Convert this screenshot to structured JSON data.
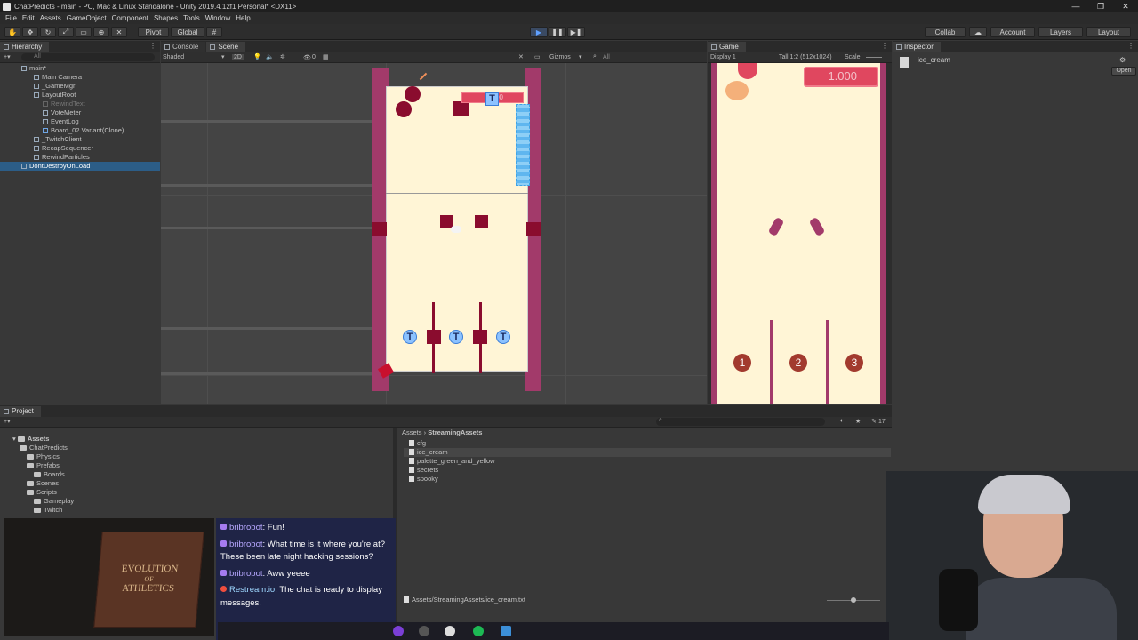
{
  "window": {
    "title": "ChatPredicts - main - PC, Mac & Linux Standalone - Unity 2019.4.12f1 Personal* <DX11>",
    "minimize": "—",
    "maximize": "❐",
    "close": "✕"
  },
  "menu": [
    "File",
    "Edit",
    "Assets",
    "GameObject",
    "Component",
    "Shapes",
    "Tools",
    "Window",
    "Help"
  ],
  "toolbar": {
    "pivot": "Pivot",
    "global": "Global",
    "collab": "Collab",
    "account": "Account",
    "layers": "Layers",
    "layout": "Layout"
  },
  "hierarchy": {
    "tab": "Hierarchy",
    "search_placeholder": "All",
    "items": [
      {
        "label": "main*"
      },
      {
        "label": "Main Camera"
      },
      {
        "label": "_GameMgr"
      },
      {
        "label": "LayoutRoot"
      },
      {
        "label": "RewindText"
      },
      {
        "label": "VoteMeter"
      },
      {
        "label": "EventLog"
      },
      {
        "label": "Board_02 Variant(Clone)"
      },
      {
        "label": "_TwitchClient"
      },
      {
        "label": "RecapSequencer"
      },
      {
        "label": "RewindParticles"
      },
      {
        "label": "DontDestroyOnLoad"
      }
    ]
  },
  "scene": {
    "tabs": [
      "Console",
      "Scene"
    ],
    "shading": "Shaded",
    "mode_2d": "2D",
    "layer_count": "0",
    "gizmos": "Gizmos",
    "search_placeholder": "All",
    "label_text": "1000",
    "t_icon": "T"
  },
  "game": {
    "tab": "Game",
    "display": "Display 1",
    "aspect": "Tall 1:2 (512x1024)",
    "scale_label": "Scale",
    "score": "1.000",
    "peg_labels": [
      "1",
      "2",
      "3"
    ]
  },
  "inspector": {
    "tab": "Inspector",
    "asset_name": "ice_cream",
    "open_button": "Open"
  },
  "project": {
    "tab": "Project",
    "tree": [
      {
        "label": "Assets"
      },
      {
        "label": "ChatPredicts"
      },
      {
        "label": "Physics"
      },
      {
        "label": "Prefabs"
      },
      {
        "label": "Boards"
      },
      {
        "label": "Scenes"
      },
      {
        "label": "Scripts"
      },
      {
        "label": "Gameplay"
      },
      {
        "label": "Twitch"
      }
    ],
    "breadcrumb": [
      "Assets",
      "StreamingAssets"
    ],
    "breadcrumb_sep": "›",
    "files": [
      {
        "label": "cfg"
      },
      {
        "label": "ice_cream"
      },
      {
        "label": "palette_green_and_yellow"
      },
      {
        "label": "secrets"
      },
      {
        "label": "spooky"
      }
    ],
    "status_path": "Assets/StreamingAssets/ice_cream.txt",
    "count_badge": "17"
  },
  "book": {
    "title_line1": "EVOLUTION",
    "title_line2": "OF",
    "title_line3": "ATHLETICS"
  },
  "chat": {
    "messages": [
      {
        "user": "bribrobot",
        "text": "Fun!"
      },
      {
        "user": "bribrobot",
        "text": "What time is it where you're at? These been late night hacking sessions?"
      },
      {
        "user": "bribrobot",
        "text": "Aww yeeee"
      },
      {
        "user": "Restream.io",
        "text": "The chat is ready to display messages."
      }
    ]
  },
  "colors": {
    "board_bg": "#fff5d6",
    "wall": "#a23a6a",
    "peg": "#8a0c2e",
    "accent_blue": "#3a7dd8"
  }
}
